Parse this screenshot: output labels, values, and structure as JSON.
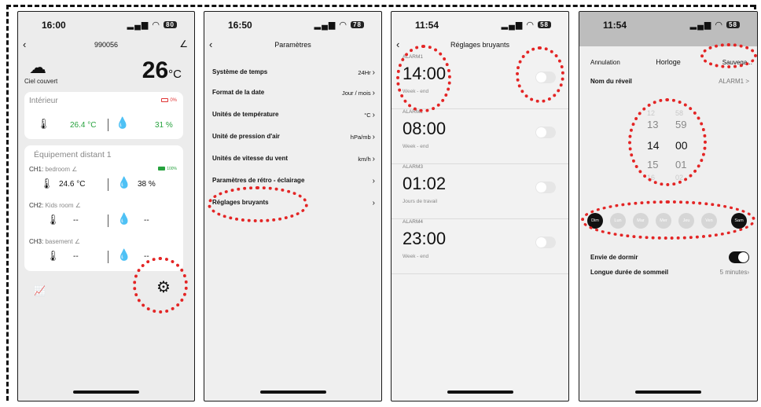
{
  "screen1": {
    "time": "16:00",
    "battery": "80",
    "device_id": "990056",
    "condition": "Ciel couvert",
    "temperature": "26",
    "temperature_unit": "°C",
    "indoor": {
      "title": "Intérieur",
      "battery": "0%",
      "temp": "26.4 °C",
      "humidity": "31 %"
    },
    "remote": {
      "title": "Équipement distant 1",
      "channels": [
        {
          "label": "CH1:",
          "name": "bedroom",
          "battery": "100%",
          "temp": "24.6 °C",
          "humidity": "38 %"
        },
        {
          "label": "CH2:",
          "name": "Kids room",
          "temp": "--",
          "humidity": "--"
        },
        {
          "label": "CH3:",
          "name": "basement",
          "temp": "--",
          "humidity": "--"
        }
      ]
    }
  },
  "screen2": {
    "time": "16:50",
    "battery": "78",
    "title": "Paramètres",
    "rows": [
      {
        "label": "Système de temps",
        "value": "24Hr"
      },
      {
        "label": "Format de la date",
        "value": "Jour / mois"
      },
      {
        "label": "Unités de température",
        "value": "°C"
      },
      {
        "label": "Unité de pression d'air",
        "value": "hPa/mb"
      },
      {
        "label": "Unités de vitesse du vent",
        "value": "km/h"
      },
      {
        "label": "Paramètres de rétro - éclairage",
        "value": ""
      },
      {
        "label": "Réglages bruyants",
        "value": ""
      }
    ]
  },
  "screen3": {
    "time": "11:54",
    "battery": "58",
    "title": "Réglages bruyants",
    "alarms": [
      {
        "label": "ALARM1",
        "time": "14:00",
        "repeat": "Week - end"
      },
      {
        "label": "ALARM2",
        "time": "08:00",
        "repeat": "Week - end"
      },
      {
        "label": "ALARM3",
        "time": "01:02",
        "repeat": "Jours de travail"
      },
      {
        "label": "ALARM4",
        "time": "23:00",
        "repeat": "Week - end"
      }
    ]
  },
  "screen4": {
    "time": "11:54",
    "battery": "58",
    "cancel": "Annulation",
    "title": "Horloge",
    "save": "Sauvega...",
    "alarm_name_label": "Nom du réveil",
    "alarm_name_value": "ALARM1 >",
    "picker_rows": [
      {
        "h": "12",
        "m": "58"
      },
      {
        "h": "13",
        "m": "59"
      },
      {
        "h": "14",
        "m": "00"
      },
      {
        "h": "15",
        "m": "01"
      },
      {
        "h": "16",
        "m": "02"
      }
    ],
    "days": [
      {
        "label": "Dim",
        "on": true
      },
      {
        "label": "Lun",
        "on": false
      },
      {
        "label": "Mar",
        "on": false
      },
      {
        "label": "Mer",
        "on": false
      },
      {
        "label": "Jeu",
        "on": false
      },
      {
        "label": "Ven",
        "on": false
      },
      {
        "label": "Sam",
        "on": true
      }
    ],
    "sleep_label": "Envie de dormir",
    "snooze_label": "Longue durée de sommeil",
    "snooze_value": "5 minutes"
  },
  "colors": {
    "annotation": "#e32525",
    "accent_green": "#27a23e",
    "battery_red": "#e03434"
  }
}
